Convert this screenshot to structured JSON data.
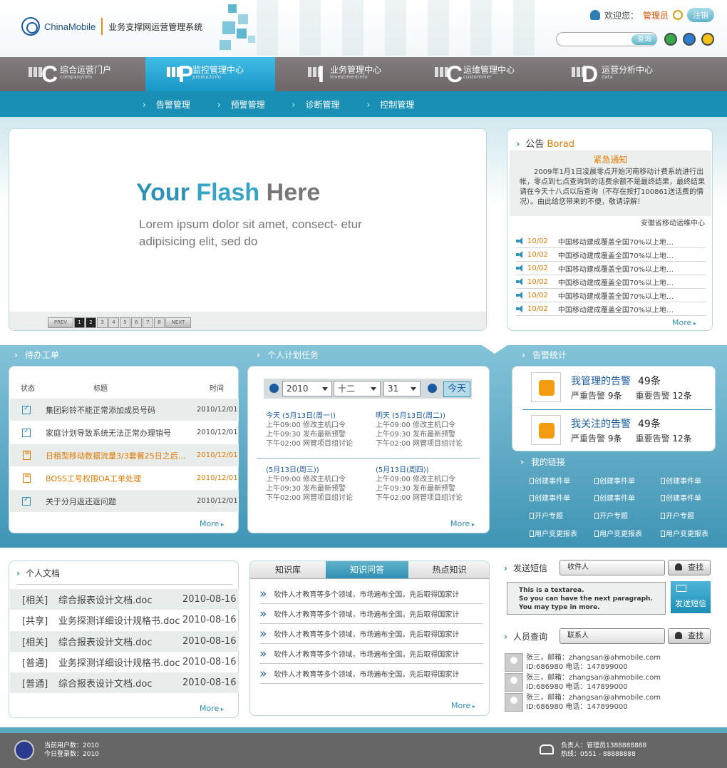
{
  "brand": {
    "logo": "ChinaMobile",
    "system": "业务支撑网运营管理系统"
  },
  "user": {
    "welcome": "欢迎您：",
    "role": "管理员",
    "logout": "注销"
  },
  "search": {
    "placeholder": "",
    "button": "查询"
  },
  "nav": [
    {
      "label": "综合运营门户",
      "sub": "companyinfo",
      "letter": "C"
    },
    {
      "label": "监控管理中心",
      "sub": "productinfo",
      "letter": "P"
    },
    {
      "label": "业务管理中心",
      "sub": "investmentinfo",
      "letter": "I"
    },
    {
      "label": "运维管理中心",
      "sub": "custommer",
      "letter": "C"
    },
    {
      "label": "运营分析中心",
      "sub": "data",
      "letter": "D"
    }
  ],
  "subnav": [
    "告警管理",
    "预警管理",
    "诊断管理",
    "控制管理"
  ],
  "flash": {
    "your": "Your",
    "flash": "Flash",
    "here": "Here",
    "body": "Lorem ipsum dolor sit amet, consect- etur adipisicing elit, sed do"
  },
  "pager": {
    "prev": "PREV",
    "next": "NEXT",
    "pages": [
      "1",
      "2",
      "3",
      "4",
      "5",
      "6",
      "7",
      "8"
    ]
  },
  "notice": {
    "title": "公告",
    "title_en": "Borad",
    "urgent": "紧急通知",
    "body": "2009年1月1日凌晨零点开始河南移动计费系统进行出帐，零点到七点查询到的话费余额不是最终结果，最终结果请在今天十八点以后查询（不存在按打100861送话费的情况）。由此给您带来的不便，敬请谅解！",
    "sign": "安徽省移动运维中心",
    "items": [
      {
        "date": "10/02",
        "text": "中国移动建成覆盖全国70%以上地…"
      },
      {
        "date": "10/02",
        "text": "中国移动建成覆盖全国70%以上地…"
      },
      {
        "date": "10/02",
        "text": "中国移动建成覆盖全国70%以上地…"
      },
      {
        "date": "10/02",
        "text": "中国移动建成覆盖全国70%以上地…"
      },
      {
        "date": "10/02",
        "text": "中国移动建成覆盖全国70%以上地…"
      },
      {
        "date": "10/02",
        "text": "中国移动建成覆盖全国70%以上地…"
      }
    ],
    "more": "More"
  },
  "todo": {
    "title": "待办工单",
    "cols": [
      "状态",
      "标题",
      "时间"
    ],
    "rows": [
      {
        "title": "集团彩铃不能正常添加成员号码",
        "date": "2010/12/01"
      },
      {
        "title": "家庭计划导致系统无法正常办理销号",
        "date": "2010/12/01"
      },
      {
        "title": "日租型移动数据流量3/3套餐25日之后…",
        "date": "2010/12/01"
      },
      {
        "title": "BOSS工号权限OA工单处理",
        "date": "2010/12/01"
      },
      {
        "title": "关于分月返还返问题",
        "date": "2010/12/01"
      }
    ],
    "more": "More"
  },
  "plan": {
    "title": "个人计划任务",
    "year": "2010",
    "month": "十二",
    "day": "31",
    "today": "今天",
    "blocks": [
      {
        "head": "今天 (5月13日(周一))",
        "lines": [
          "上午09:00 修改主机口令",
          "上午09:30 发布最新预警",
          "下午02:00 网管项目组讨论"
        ]
      },
      {
        "head": "明天 (5月13日(周二))",
        "lines": [
          "上午09:00 修改主机口令",
          "上午09:30 发布最新预警",
          "下午02:00 网管项目组讨论"
        ]
      },
      {
        "head": "(5月13日(周三))",
        "lines": [
          "上午09:00 修改主机口令",
          "上午09:30 发布最新预警",
          "下午02:00 网管项目组讨论"
        ]
      },
      {
        "head": "(5月13日(周四))",
        "lines": [
          "上午09:00 修改主机口令",
          "上午09:30 发布最新预警",
          "下午02:00 网管项目组讨论"
        ]
      }
    ],
    "more": "More"
  },
  "alarm": {
    "title": "告警统计",
    "rows": [
      {
        "label": "我管理的告警",
        "count": "49条",
        "sev": "严重告警",
        "sev_n": "9条",
        "imp": "重要告警",
        "imp_n": "12条"
      },
      {
        "label": "我关注的告警",
        "count": "49条",
        "sev": "严重告警",
        "sev_n": "9条",
        "imp": "重要告警",
        "imp_n": "12条"
      }
    ]
  },
  "links": {
    "title": "我的链接",
    "rows": [
      [
        "创建事件单",
        "创建事件单",
        "创建事件单"
      ],
      [
        "创建事件单",
        "创建事件单",
        "创建事件单"
      ],
      [
        "开户专题",
        "开户专题",
        "开户专题"
      ],
      [
        "用户变更报表",
        "用户变更报表",
        "用户变更报表"
      ]
    ]
  },
  "docs": {
    "title": "个人文档",
    "rows": [
      {
        "cat": "[相关]",
        "name": "综合报表设计文档.doc",
        "date": "2010-08-16"
      },
      {
        "cat": "[共享]",
        "name": "业务探测详细设计规格书.doc",
        "date": "2010-08-16"
      },
      {
        "cat": "[相关]",
        "name": "综合报表设计文档.doc",
        "date": "2010-08-16"
      },
      {
        "cat": "[普通]",
        "name": "业务探测详细设计规格书.doc",
        "date": "2010-08-16"
      },
      {
        "cat": "[普通]",
        "name": "综合报表设计文档.doc",
        "date": "2010-08-16"
      }
    ],
    "more": "More"
  },
  "know": {
    "tabs": [
      "知识库",
      "知识问答",
      "热点知识"
    ],
    "items": [
      "软件人才教育等多个领域，市场遍布全国。先后取得国家计",
      "软件人才教育等多个领域，市场遍布全国。先后取得国家计",
      "软件人才教育等多个领域，市场遍布全国。先后取得国家计",
      "软件人才教育等多个领域，市场遍布全国。先后取得国家计",
      "软件人才教育等多个领域，市场遍布全国。先后取得国家计"
    ],
    "more": "More"
  },
  "sms": {
    "title": "发送短信",
    "to_placeholder": "收件人",
    "find": "查找",
    "textarea": [
      "This is a textarea.",
      "So you can have the next paragraph.",
      "You may type in more."
    ],
    "send": "发送短信"
  },
  "people": {
    "title": "人员查询",
    "placeholder": "联系人",
    "find": "查找",
    "rows": [
      {
        "l1": "张三，邮箱：zhangsan@ahmobile.com",
        "l2": "ID:686980  电话：147899000"
      },
      {
        "l1": "张三，邮箱：zhangsan@ahmobile.com",
        "l2": "ID:686980  电话：147899000"
      },
      {
        "l1": "张三，邮箱：zhangsan@ahmobile.com",
        "l2": "ID:686980  电话：147899000"
      }
    ]
  },
  "footer": {
    "users": "当前用户数：2010",
    "logins": "今日登录数：2010",
    "owner": "负责人：管理员1388888888",
    "hotline": "热线：0551 - 88888888"
  }
}
